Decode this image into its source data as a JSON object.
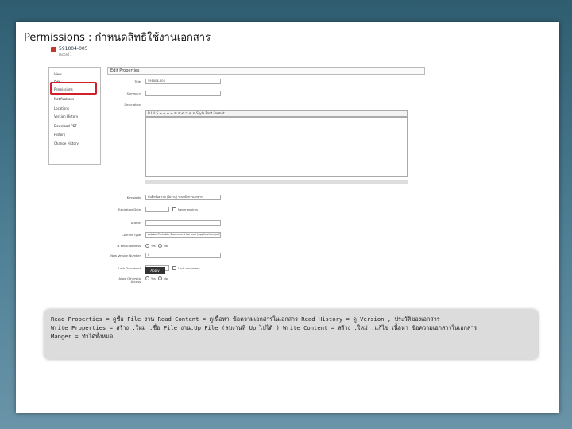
{
  "slide": {
    "title": "Permissions : กำหนดสิทธิใช้งานเอกสาร"
  },
  "screenshot": {
    "record_id": "591004-005",
    "record_sub": "record 1",
    "nav": [
      "View",
      "Edit",
      "Permissions",
      "Notifications",
      "Locations",
      "Version History",
      "Download PDF",
      "History",
      "Change History"
    ],
    "panel_title": "Edit Properties",
    "form": {
      "title_label": "Title",
      "title_value": "591004-005",
      "summary_label": "Summary",
      "description_label": "Description",
      "toolbar_text": "B  I  U  S   ≡ ≡ ≡ ≡   ☰ ☰   ↶ ↷   ⊞ ⊟   Style   Font   Format",
      "keywords_label": "Keywords",
      "keywords_value": "บันทึกข้อความ (ไม่ระบุ) ระบบจัดการเอกสาร",
      "expiration_label": "Expiration Date",
      "expiration_note": "Never expires",
      "author_label": "Author",
      "content_type_label": "Content Type",
      "content_type_value": "Adobe Portable Document Format (application/pdf)",
      "email_label": "Is Email Address",
      "email_yes": "Yes",
      "email_no": "No",
      "version_label": "New Version Number",
      "version_value": "0",
      "lock_label": "Lock Document",
      "lock_note": "Lock document",
      "allow_label": "Allow Others to Access",
      "allow_yes": "Yes",
      "allow_no": "No",
      "apply_label": "Apply"
    }
  },
  "caption": {
    "line1": "Read Properties = ดูชื่อ File งาน   Read Content = ดูเนื้อหา ข้อความเอกสารในเอกสาร   Read History = ดู Version , ประวัติของเอกสาร",
    "line2": "Write Properties = สร้าง ,ใหม่ ,ชื่อ File งาน,Up File (ลบงานที่ Up ไปได้ )  Write Content = สร้าง ,ใหม่ ,แก้ไข เนื้อหา ข้อความเอกสารในเอกสาร",
    "line3": "Manger = ทำได้ทั้งหมด"
  }
}
